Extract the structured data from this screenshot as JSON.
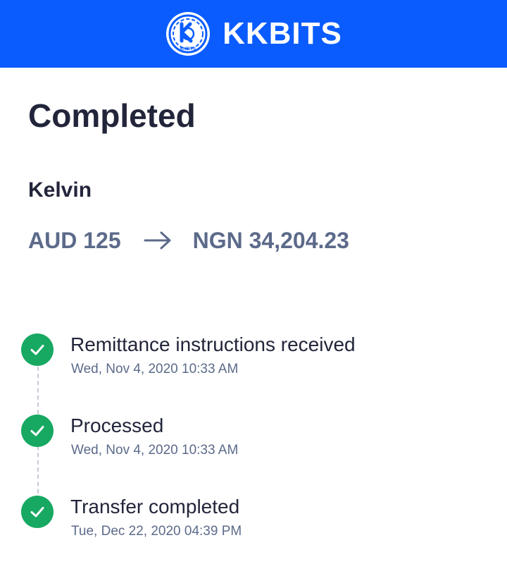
{
  "header": {
    "brand_name": "KKBITS",
    "logo_icon": "kkbits-logo-icon",
    "logo_text": "KKBITS",
    "background_color": "#0a5cff"
  },
  "transfer": {
    "status_title": "Completed",
    "recipient_name": "Kelvin",
    "from_amount": "AUD 125",
    "to_amount": "NGN 34,204.23",
    "arrow_icon": "arrow-right-icon"
  },
  "timeline": {
    "check_color": "#17a862",
    "steps": [
      {
        "label": "Remittance instructions received",
        "timestamp": "Wed, Nov 4, 2020 10:33 AM",
        "icon": "check-circle-icon"
      },
      {
        "label": "Processed",
        "timestamp": "Wed, Nov 4, 2020 10:33 AM",
        "icon": "check-circle-icon"
      },
      {
        "label": "Transfer completed",
        "timestamp": "Tue, Dec 22, 2020 04:39 PM",
        "icon": "check-circle-icon"
      }
    ]
  }
}
